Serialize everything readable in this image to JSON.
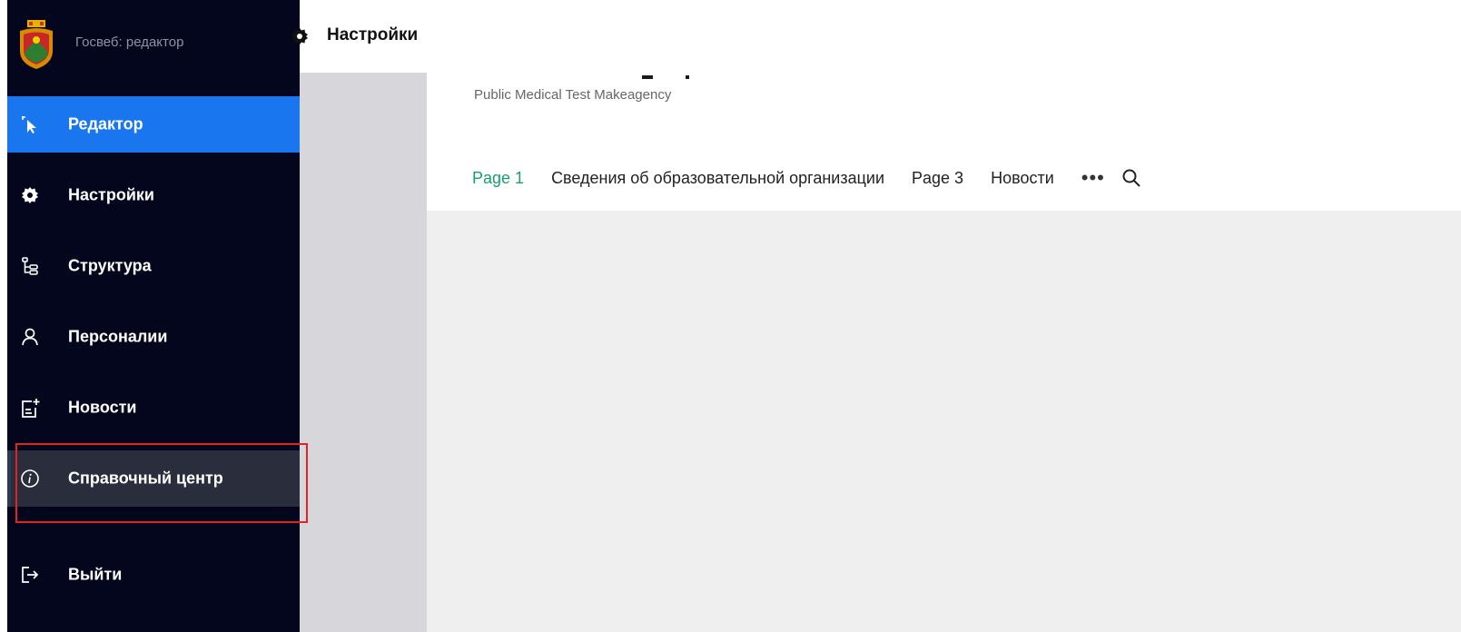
{
  "sidebar": {
    "app_name": "Госвеб: редактор",
    "items": [
      {
        "label": "Редактор",
        "icon": "cursor-icon"
      },
      {
        "label": "Настройки",
        "icon": "gear-icon"
      },
      {
        "label": "Структура",
        "icon": "structure-icon"
      },
      {
        "label": "Персоналии",
        "icon": "person-icon"
      },
      {
        "label": "Новости",
        "icon": "news-add-icon"
      },
      {
        "label": "Справочный центр",
        "icon": "info-icon"
      },
      {
        "label": "Выйти",
        "icon": "logout-icon"
      }
    ],
    "active_color": "#1976ef",
    "background": "#03061c"
  },
  "topbar": {
    "title": "Настройки",
    "icon": "gear-icon"
  },
  "site": {
    "org_name": "Public Medical Test Makeagency",
    "tabs": [
      {
        "label": "Page 1",
        "active": true
      },
      {
        "label": "Сведения об образовательной организации",
        "active": false
      },
      {
        "label": "Page 3",
        "active": false
      },
      {
        "label": "Новости",
        "active": false
      }
    ],
    "more": "•••",
    "accent": "#17a06a"
  },
  "annotation": {
    "highlight_color": "#e02424"
  }
}
